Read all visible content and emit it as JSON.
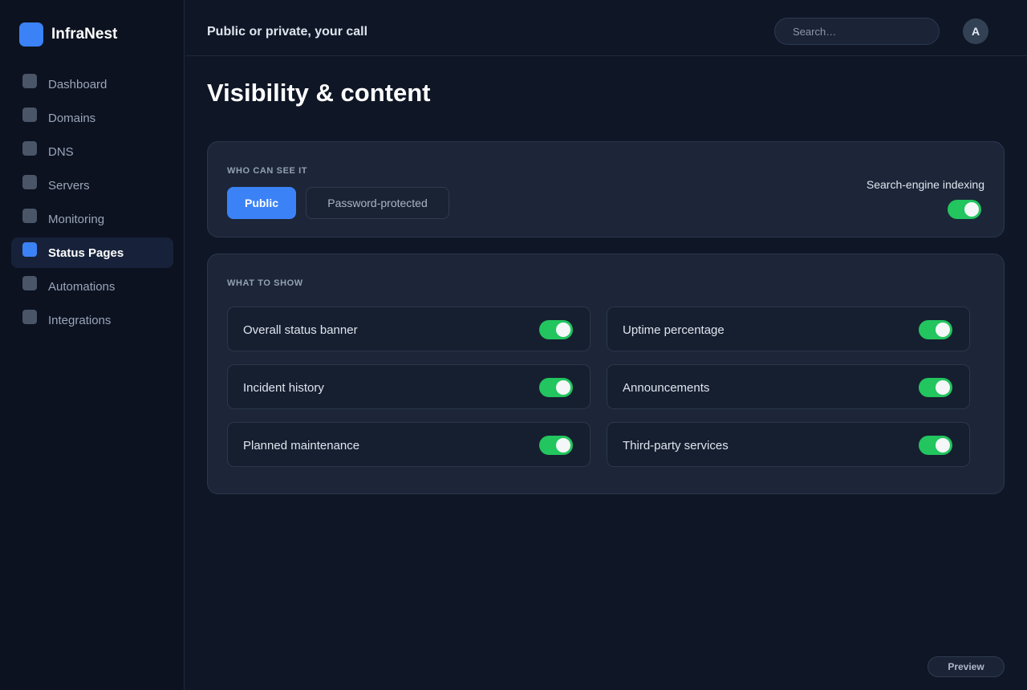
{
  "brand": {
    "name": "InfraNest",
    "accent": "#3b82f6"
  },
  "sidebar": {
    "items": [
      {
        "label": "Dashboard",
        "active": false
      },
      {
        "label": "Domains",
        "active": false
      },
      {
        "label": "DNS",
        "active": false
      },
      {
        "label": "Servers",
        "active": false
      },
      {
        "label": "Monitoring",
        "active": false
      },
      {
        "label": "Status Pages",
        "active": true
      },
      {
        "label": "Automations",
        "active": false
      },
      {
        "label": "Integrations",
        "active": false
      }
    ]
  },
  "header": {
    "title": "Public or private, your call",
    "search_placeholder": "Search…",
    "avatar_initial": "A"
  },
  "page": {
    "title": "Visibility & content"
  },
  "visibility": {
    "section_label": "WHO CAN SEE IT",
    "options": [
      "Public",
      "Password-protected"
    ],
    "selected": "Public",
    "indexing_label": "Search-engine indexing",
    "indexing_on": true
  },
  "content": {
    "section_label": "WHAT TO SHOW",
    "options": [
      {
        "label": "Overall status banner",
        "on": true
      },
      {
        "label": "Uptime percentage",
        "on": true
      },
      {
        "label": "Incident history",
        "on": true
      },
      {
        "label": "Announcements",
        "on": true
      },
      {
        "label": "Planned maintenance",
        "on": true
      },
      {
        "label": "Third-party services",
        "on": true
      }
    ]
  },
  "footer": {
    "preview_label": "Preview"
  },
  "colors": {
    "toggle_on": "#22c55e",
    "background": "#0f1626",
    "card": "#1c2638"
  }
}
